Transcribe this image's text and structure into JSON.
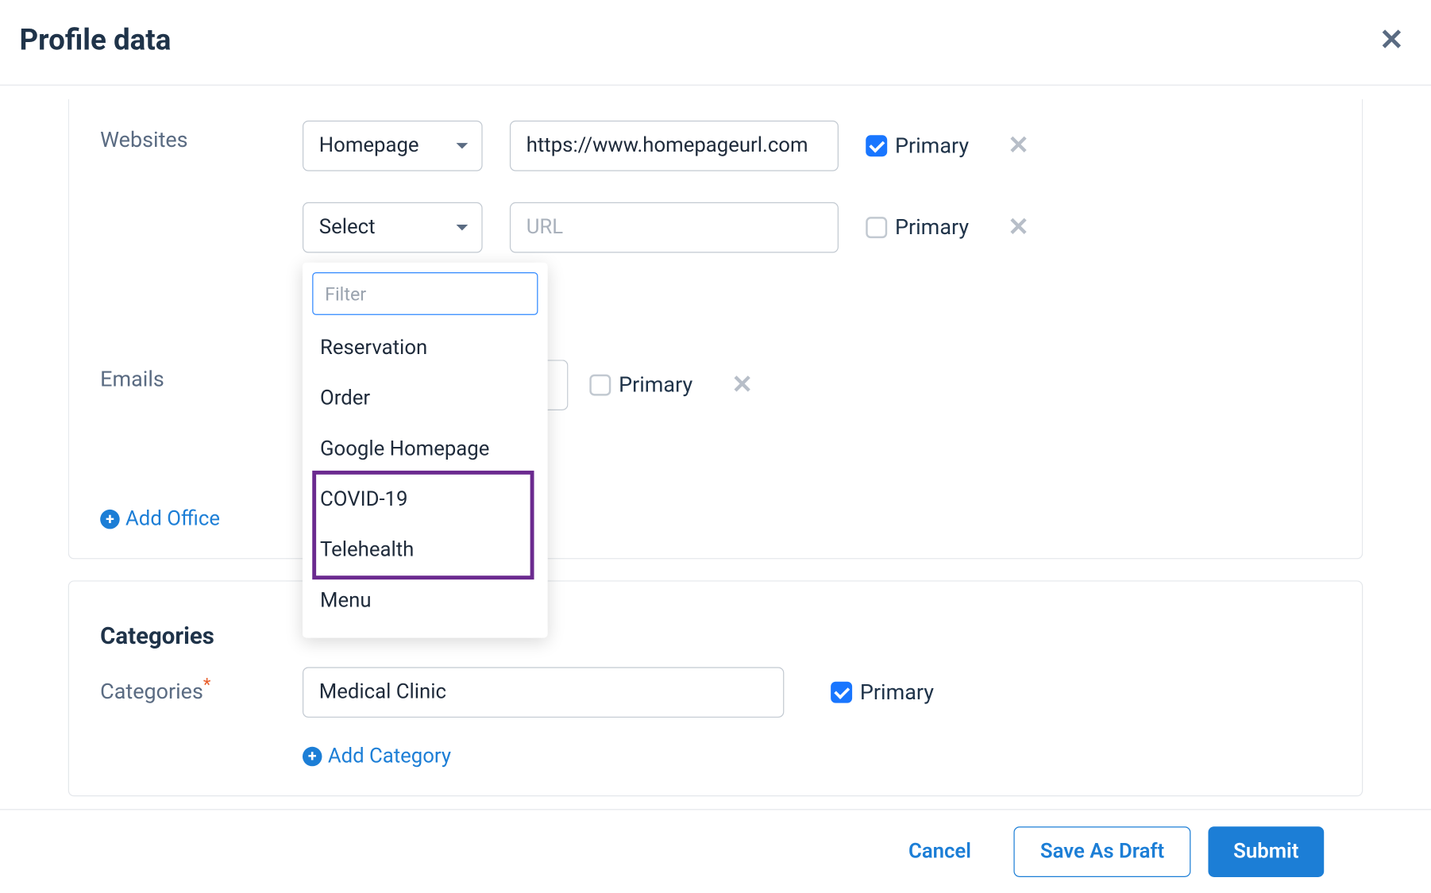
{
  "header": {
    "title": "Profile data"
  },
  "websites": {
    "label": "Websites",
    "primary_label": "Primary",
    "rows": [
      {
        "type_value": "Homepage",
        "url_value": "https://www.homepageurl.com",
        "url_placeholder": "URL",
        "primary": true
      },
      {
        "type_value": "Select",
        "url_value": "",
        "url_placeholder": "URL",
        "primary": false
      }
    ],
    "dropdown": {
      "filter_placeholder": "Filter",
      "options": [
        "Reservation",
        "Order",
        "Google Homepage",
        "COVID-19",
        "Telehealth",
        "Menu"
      ]
    }
  },
  "emails": {
    "label": "Emails",
    "primary_label": "Primary",
    "primary": false
  },
  "add_office": {
    "label": "Add Office"
  },
  "categories": {
    "section_label": "Categories",
    "field_label": "Categories",
    "value": "Medical Clinic",
    "primary_label": "Primary",
    "primary": true,
    "add_label": "Add Category"
  },
  "footer": {
    "cancel": "Cancel",
    "save_draft": "Save As Draft",
    "submit": "Submit"
  }
}
